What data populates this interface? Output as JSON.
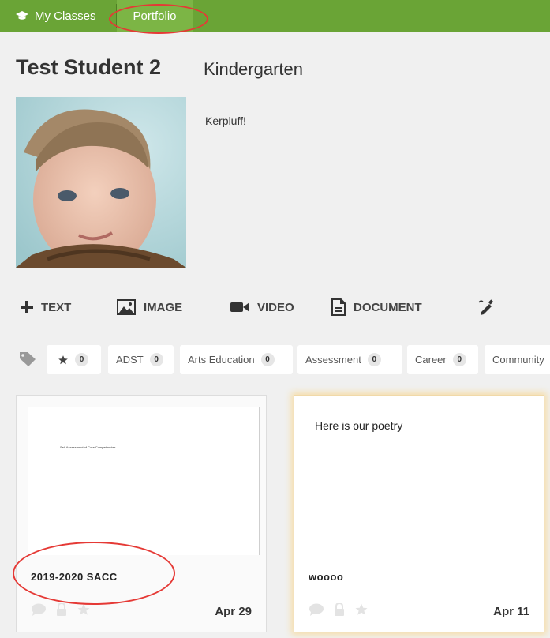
{
  "nav": {
    "my_classes": "My Classes",
    "portfolio": "Portfolio"
  },
  "student": {
    "name": "Test Student 2",
    "grade": "Kindergarten",
    "bio": "Kerpluff!"
  },
  "toolbar": {
    "text": "TEXT",
    "image": "IMAGE",
    "video": "VIDEO",
    "document": "DOCUMENT"
  },
  "tags": [
    {
      "label": "",
      "icon": "star-icon",
      "count": "0"
    },
    {
      "label": "ADST",
      "count": "0"
    },
    {
      "label": "Arts Education",
      "count": "0"
    },
    {
      "label": "Assessment",
      "count": "0"
    },
    {
      "label": "Career",
      "count": "0"
    },
    {
      "label": "Community",
      "count": ""
    }
  ],
  "posts": [
    {
      "title": "2019-2020 SACC",
      "preview_text": "Self Assessment of Core Competencies",
      "date": "Apr 29"
    },
    {
      "title": "woooo",
      "body": "Here is our poetry",
      "date": "Apr 11"
    }
  ],
  "colors": {
    "topbar": "#6aa436",
    "annotation": "#e53935",
    "highlight_glow": "#f6deaa"
  }
}
